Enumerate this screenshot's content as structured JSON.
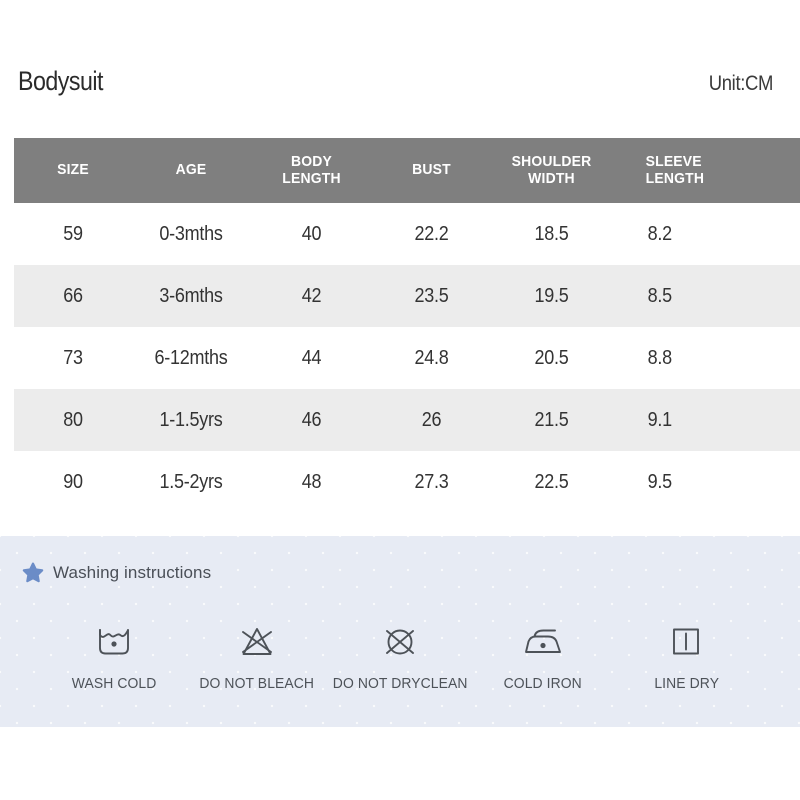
{
  "header": {
    "product_title": "Bodysuit",
    "unit_label": "Unit:CM"
  },
  "size_table": {
    "columns": [
      {
        "label": "SIZE",
        "line1": "SIZE",
        "line2": ""
      },
      {
        "label": "AGE",
        "line1": "AGE",
        "line2": ""
      },
      {
        "label": "BODY LENGTH",
        "line1": "BODY",
        "line2": "LENGTH"
      },
      {
        "label": "BUST",
        "line1": "BUST",
        "line2": ""
      },
      {
        "label": "SHOULDER WIDTH",
        "line1": "SHOULDER",
        "line2": "WIDTH"
      },
      {
        "label": "SLEEVE LENGTH",
        "line1": "SLEEVE",
        "line2": "LENGTH"
      }
    ],
    "rows": [
      {
        "size": "59",
        "age": "0-3mths",
        "body_length": "40",
        "bust": "22.2",
        "shoulder_width": "18.5",
        "sleeve_length": "8.2"
      },
      {
        "size": "66",
        "age": "3-6mths",
        "body_length": "42",
        "bust": "23.5",
        "shoulder_width": "19.5",
        "sleeve_length": "8.5"
      },
      {
        "size": "73",
        "age": "6-12mths",
        "body_length": "44",
        "bust": "24.8",
        "shoulder_width": "20.5",
        "sleeve_length": "8.8"
      },
      {
        "size": "80",
        "age": "1-1.5yrs",
        "body_length": "46",
        "bust": "26",
        "shoulder_width": "21.5",
        "sleeve_length": "9.1"
      },
      {
        "size": "90",
        "age": "1.5-2yrs",
        "body_length": "48",
        "bust": "27.3",
        "shoulder_width": "22.5",
        "sleeve_length": "9.5"
      }
    ]
  },
  "washing": {
    "heading": "Washing instructions",
    "icons": [
      {
        "caption": "WASH COLD",
        "icon": "wash-cold-icon"
      },
      {
        "caption": "DO NOT BLEACH",
        "icon": "do-not-bleach-icon"
      },
      {
        "caption": "DO NOT DRYCLEAN",
        "icon": "do-not-dryclean-icon"
      },
      {
        "caption": "COLD IRON",
        "icon": "cold-iron-icon"
      },
      {
        "caption": "LINE DRY",
        "icon": "line-dry-icon"
      }
    ]
  },
  "colors": {
    "table_header_bg": "#7f7f7f",
    "row_alt_bg": "#ececec",
    "wash_panel_bg": "#e7ebf4",
    "star_blue": "#6b8cc7",
    "text_dark": "#333333"
  }
}
